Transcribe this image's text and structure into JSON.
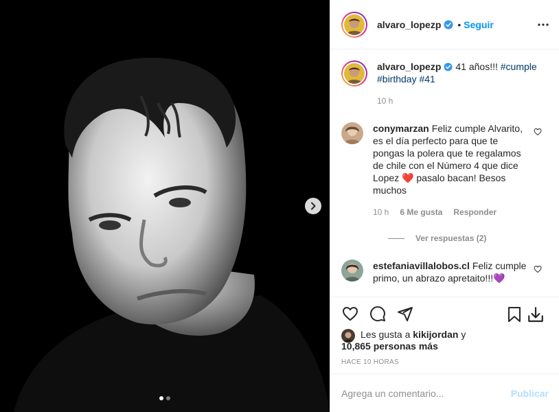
{
  "post": {
    "username": "alvaro_lopezp",
    "follow_label": "Seguir",
    "separator": "•",
    "caption_text": "41 años!!!",
    "caption_hashtags": [
      "#cumple",
      "#birthday",
      "#41"
    ],
    "caption_time": "10 h"
  },
  "comments": [
    {
      "username": "conymarzan",
      "text_part1": "Feliz cumple Alvarito, es el día perfecto para que te pongas la polera que te regalamos de chile con el Número 4 que dice Lopez",
      "emoji": "❤️",
      "text_part2": "pasalo bacan! Besos muchos",
      "time": "10 h",
      "likes": "6 Me gusta",
      "reply_label": "Responder",
      "view_replies": "Ver respuestas (2)"
    },
    {
      "username": "estefaniavillalobos.cl",
      "text_part1": "Feliz cumple primo, un abrazo apretaito!!!",
      "emoji": "💜"
    }
  ],
  "likes": {
    "prefix": "Les gusta a",
    "user": "kikijordan",
    "connector": "y",
    "count": "10,865 personas más"
  },
  "posted_ago": "HACE 10 HORAS",
  "comment_box": {
    "placeholder": "Agrega un comentario...",
    "publish_label": "Publicar"
  },
  "carousel": {
    "current": 1,
    "total": 2
  },
  "colors": {
    "link": "#0095f6",
    "verified": "#3897f0",
    "muted": "#8e8e8e",
    "publish_disabled": "#b2dffc"
  },
  "icons": [
    "verified-badge-icon",
    "more-options-icon",
    "chevron-right-icon",
    "heart-icon",
    "comment-icon",
    "share-icon",
    "save-icon",
    "download-icon"
  ]
}
